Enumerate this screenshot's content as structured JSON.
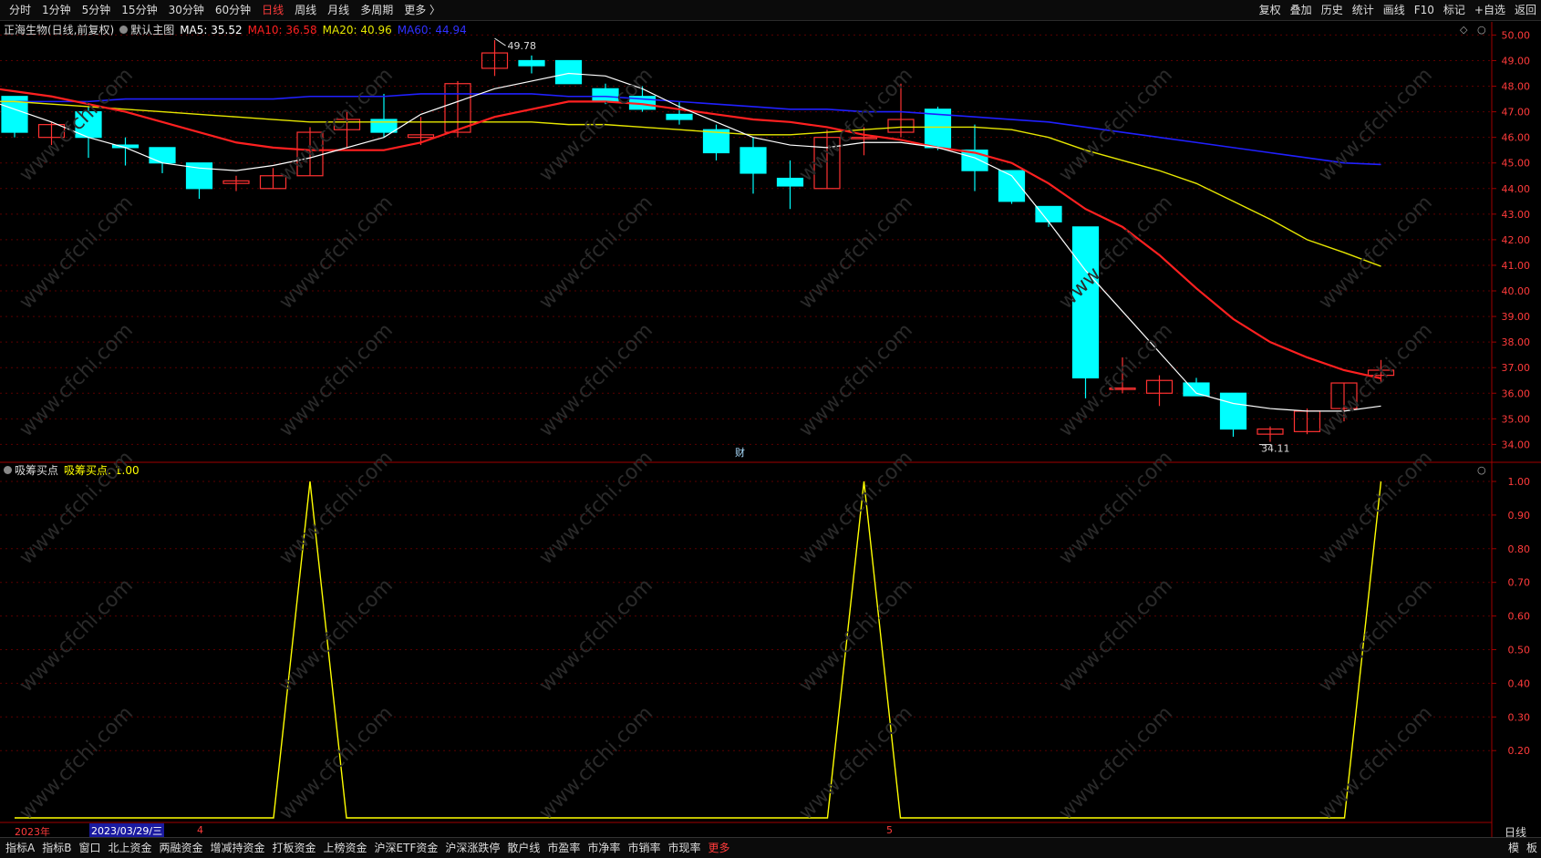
{
  "topbar": {
    "tabs": [
      "分时",
      "1分钟",
      "5分钟",
      "15分钟",
      "30分钟",
      "60分钟",
      "日线",
      "周线",
      "月线",
      "多周期",
      "更多 〉"
    ],
    "active_tab": "日线",
    "right_buttons": [
      "复权",
      "叠加",
      "历史",
      "统计",
      "画线",
      "F10",
      "标记",
      "+自选",
      "返回"
    ]
  },
  "legend": {
    "title": "正海生物(日线,前复权)",
    "main_label": "默认主图",
    "ma5": "MA5: 35.52",
    "ma10": "MA10: 36.58",
    "ma20": "MA20: 40.96",
    "ma60": "MA60: 44.94"
  },
  "indicator_legend": {
    "name": "吸筹买点",
    "value_text": "吸筹买点: 1.00"
  },
  "markers": {
    "high_label": "49.78",
    "low_label": "34.11",
    "cai_label": "财"
  },
  "colors": {
    "up": "#ff3232",
    "down": "#00ffff",
    "ma5": "#ffffff",
    "ma10": "#ff2020",
    "ma20": "#e6e600",
    "ma60": "#2020ff",
    "indicator": "#ffff00",
    "axis": "#a00000"
  },
  "price_axis": {
    "ticks": [
      "50.00",
      "49.00",
      "48.00",
      "47.00",
      "46.00",
      "45.00",
      "44.00",
      "43.00",
      "42.00",
      "41.00",
      "40.00",
      "39.00",
      "38.00",
      "37.00",
      "36.00",
      "35.00",
      "34.00"
    ],
    "min": 33.55,
    "max": 50.3
  },
  "indicator_axis": {
    "ticks": [
      "1.00",
      "0.90",
      "0.80",
      "0.70",
      "0.60",
      "0.50",
      "0.40",
      "0.30",
      "0.20"
    ],
    "min": 0,
    "max": 1.0
  },
  "date_axis": {
    "year": "2023年",
    "cursor_date": "2023/03/29/三",
    "month_4": "4",
    "month_5": "5",
    "period_label": "日线"
  },
  "bottombar": {
    "tabs": [
      "指标A",
      "指标B",
      "窗口",
      "北上资金",
      "两融资金",
      "增减持资金",
      "打板资金",
      "上榜资金",
      "沪深ETF资金",
      "沪深涨跌停",
      "散户线",
      "市盈率",
      "市净率",
      "市销率",
      "市现率",
      "更多"
    ],
    "active_tab": "更多",
    "right": [
      "模",
      "板"
    ]
  },
  "chart_data": {
    "type": "candlestick",
    "ohlc": [
      [
        47.6,
        47.6,
        46.0,
        46.2
      ],
      [
        46.0,
        46.6,
        45.7,
        46.5
      ],
      [
        47.0,
        47.2,
        45.2,
        46.0
      ],
      [
        45.7,
        46.0,
        44.9,
        45.6
      ],
      [
        45.6,
        45.6,
        44.6,
        45.0
      ],
      [
        45.0,
        45.0,
        43.6,
        44.0
      ],
      [
        44.2,
        44.5,
        43.9,
        44.3
      ],
      [
        44.0,
        44.8,
        44.0,
        44.5
      ],
      [
        44.5,
        46.4,
        44.5,
        46.2
      ],
      [
        46.3,
        47.0,
        45.6,
        46.7
      ],
      [
        46.7,
        47.7,
        46.0,
        46.2
      ],
      [
        46.0,
        46.8,
        45.7,
        46.1
      ],
      [
        46.2,
        48.2,
        46.0,
        48.1
      ],
      [
        48.7,
        49.8,
        48.4,
        49.3
      ],
      [
        49.0,
        49.2,
        48.5,
        48.8
      ],
      [
        49.0,
        49.0,
        48.1,
        48.1
      ],
      [
        47.9,
        48.1,
        47.3,
        47.4
      ],
      [
        47.6,
        48.0,
        47.0,
        47.1
      ],
      [
        46.9,
        47.4,
        46.5,
        46.7
      ],
      [
        46.3,
        46.5,
        45.1,
        45.4
      ],
      [
        45.6,
        46.0,
        43.8,
        44.6
      ],
      [
        44.4,
        45.1,
        43.2,
        44.1
      ],
      [
        44.0,
        46.3,
        44.0,
        46.0
      ],
      [
        46.0,
        46.4,
        45.3,
        46.0
      ],
      [
        46.2,
        48.1,
        46.0,
        46.7
      ],
      [
        47.1,
        47.2,
        45.5,
        45.6
      ],
      [
        45.5,
        46.5,
        43.9,
        44.7
      ],
      [
        44.7,
        44.7,
        43.4,
        43.5
      ],
      [
        43.3,
        43.3,
        42.5,
        42.7
      ],
      [
        42.5,
        42.5,
        35.8,
        36.6
      ],
      [
        36.2,
        37.4,
        36.0,
        36.2
      ],
      [
        36.0,
        36.7,
        35.5,
        36.5
      ],
      [
        36.4,
        36.6,
        35.9,
        35.9
      ],
      [
        36.0,
        36.0,
        34.3,
        34.6
      ],
      [
        34.4,
        34.7,
        34.1,
        34.6
      ],
      [
        34.5,
        35.4,
        34.4,
        35.3
      ],
      [
        35.4,
        36.4,
        34.9,
        36.4
      ],
      [
        36.7,
        37.3,
        36.4,
        36.9
      ]
    ],
    "ma5": [
      47.6,
      47.1,
      46.6,
      46.0,
      45.6,
      45.0,
      44.8,
      44.7,
      44.9,
      45.2,
      45.6,
      46.0,
      46.9,
      47.4,
      47.9,
      48.2,
      48.5,
      48.4,
      47.9,
      47.2,
      46.6,
      46.0,
      45.7,
      45.6,
      45.8,
      45.8,
      45.6,
      45.2,
      44.5,
      42.7,
      40.8,
      39.2,
      37.6,
      36.0,
      35.6,
      35.4,
      35.3,
      35.3,
      35.5
    ],
    "ma10": [
      48.0,
      47.8,
      47.6,
      47.3,
      47.0,
      46.6,
      46.2,
      45.8,
      45.6,
      45.5,
      45.5,
      45.5,
      45.8,
      46.3,
      46.8,
      47.1,
      47.4,
      47.4,
      47.3,
      47.1,
      46.9,
      46.7,
      46.6,
      46.4,
      46.1,
      45.9,
      45.6,
      45.4,
      45.0,
      44.2,
      43.2,
      42.5,
      41.4,
      40.1,
      38.9,
      38.0,
      37.4,
      36.9,
      36.58
    ],
    "ma20": [
      47.4,
      47.4,
      47.3,
      47.2,
      47.1,
      47.0,
      46.9,
      46.8,
      46.7,
      46.6,
      46.6,
      46.6,
      46.6,
      46.6,
      46.6,
      46.6,
      46.5,
      46.5,
      46.4,
      46.3,
      46.2,
      46.1,
      46.1,
      46.2,
      46.3,
      46.4,
      46.4,
      46.4,
      46.3,
      46.0,
      45.5,
      45.1,
      44.7,
      44.2,
      43.5,
      42.8,
      42.0,
      41.5,
      40.96
    ],
    "ma60": [
      47.4,
      47.4,
      47.4,
      47.4,
      47.5,
      47.5,
      47.5,
      47.5,
      47.5,
      47.6,
      47.6,
      47.6,
      47.7,
      47.7,
      47.7,
      47.7,
      47.6,
      47.6,
      47.5,
      47.4,
      47.3,
      47.2,
      47.1,
      47.1,
      47.0,
      47.0,
      46.9,
      46.8,
      46.7,
      46.6,
      46.4,
      46.2,
      46.0,
      45.8,
      45.6,
      45.4,
      45.2,
      45.0,
      44.94
    ],
    "indicator_points": [
      [
        0,
        0
      ],
      [
        7,
        0
      ],
      [
        8,
        1
      ],
      [
        9,
        0
      ],
      [
        22,
        0
      ],
      [
        23,
        1
      ],
      [
        24,
        0
      ],
      [
        36,
        0
      ],
      [
        37,
        1
      ]
    ]
  }
}
